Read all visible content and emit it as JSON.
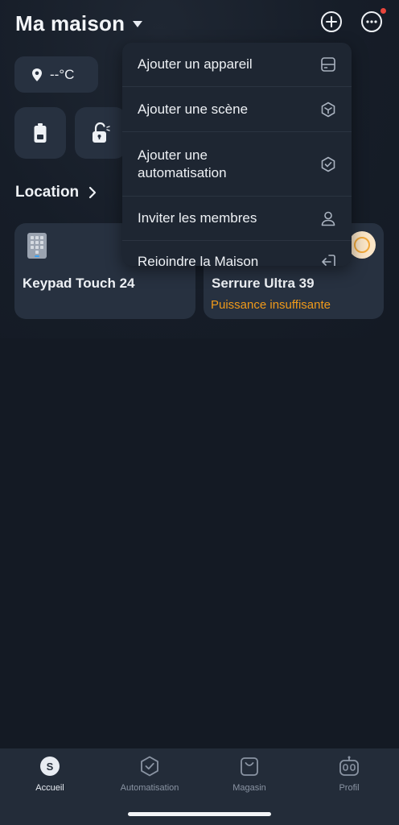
{
  "header": {
    "title": "Ma maison",
    "add_icon": "plus-circle-icon",
    "more_icon": "more-circle-icon"
  },
  "weather": {
    "temperature": "--°C",
    "icon": "location-pin-icon"
  },
  "quick_tiles": [
    {
      "icon": "battery-icon"
    },
    {
      "icon": "unlock-icon"
    }
  ],
  "section": {
    "title": "Location"
  },
  "devices": [
    {
      "name": "Keypad Touch 24",
      "icon": "keypad-icon"
    },
    {
      "name": "Serrure Ultra 39",
      "status": "Puissance insuffisante",
      "icon": "power-icon"
    }
  ],
  "menu": {
    "items": [
      {
        "label": "Ajouter un appareil",
        "icon": "device-icon"
      },
      {
        "label": "Ajouter une scène",
        "icon": "scene-icon"
      },
      {
        "label": "Ajouter une automatisation",
        "icon": "automation-icon"
      },
      {
        "label": "Inviter les membres",
        "icon": "person-icon"
      },
      {
        "label": "Rejoindre la Maison",
        "icon": "join-icon"
      }
    ]
  },
  "tabbar": {
    "items": [
      {
        "label": "Accueil",
        "active": true
      },
      {
        "label": "Automatisation",
        "active": false
      },
      {
        "label": "Magasin",
        "active": false
      },
      {
        "label": "Profil",
        "active": false
      }
    ],
    "home_glyph": "S"
  },
  "colors": {
    "background": "#141a24",
    "card": "#273140",
    "menu": "#1e2632",
    "warning": "#f09a1a",
    "notification": "#e8453c"
  }
}
